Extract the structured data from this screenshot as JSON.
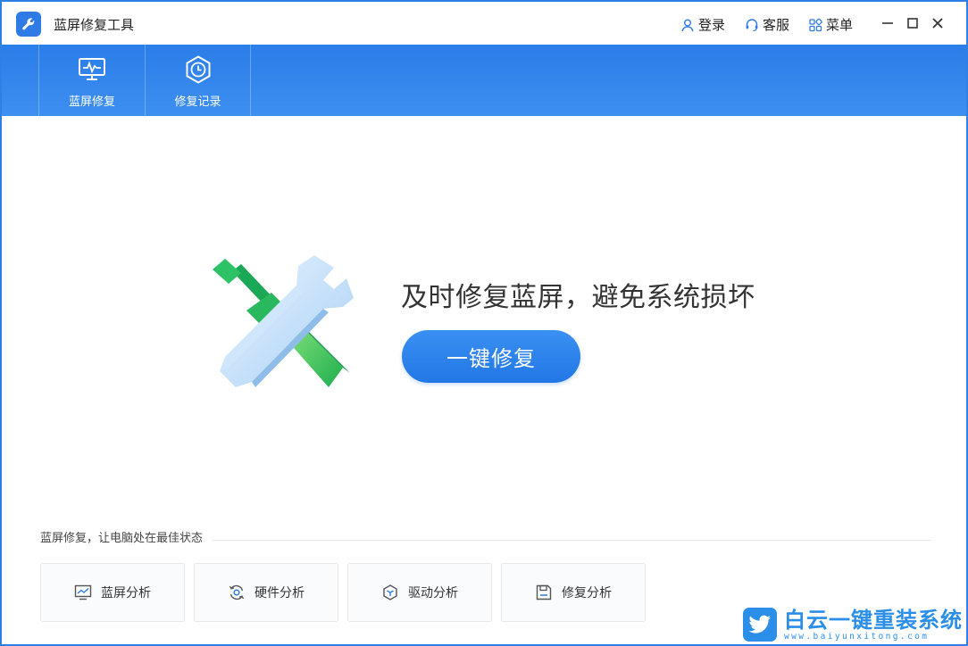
{
  "app": {
    "title": "蓝屏修复工具"
  },
  "titlebar": {
    "login_label": "登录",
    "service_label": "客服",
    "menu_label": "菜单"
  },
  "nav": {
    "tabs": [
      {
        "label": "蓝屏修复",
        "icon": "monitor-pulse-icon"
      },
      {
        "label": "修复记录",
        "icon": "clock-hexagon-icon"
      }
    ]
  },
  "hero": {
    "title": "及时修复蓝屏，避免系统损坏",
    "button_label": "一键修复",
    "illustration": "wrench-screwdriver-illustration"
  },
  "section": {
    "title": "蓝屏修复，让电脑处在最佳状态",
    "cards": [
      {
        "label": "蓝屏分析",
        "icon": "chart-monitor-icon"
      },
      {
        "label": "硬件分析",
        "icon": "refresh-gear-icon"
      },
      {
        "label": "驱动分析",
        "icon": "cube-icon"
      },
      {
        "label": "修复分析",
        "icon": "save-disk-icon"
      }
    ]
  },
  "watermark": {
    "text": "白云一键重装系统",
    "url": "www.baiyunxitong.com",
    "icon": "twitter-bird-icon"
  },
  "colors": {
    "accent": "#2f7be6",
    "navbar": "#3388ee",
    "button": "#2b82ec",
    "watermark": "#2b8ee8"
  }
}
